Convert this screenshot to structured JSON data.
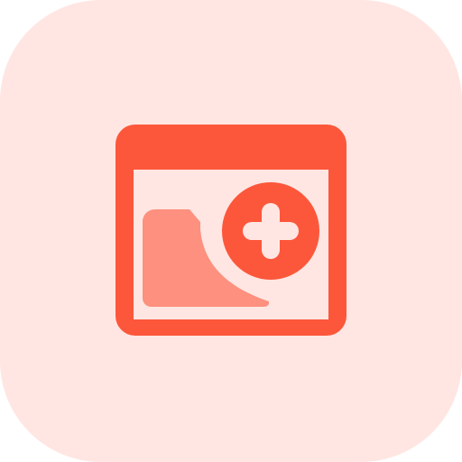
{
  "icon": {
    "name": "browser-folder-add-icon",
    "colors": {
      "background": "#FFE6E2",
      "primary": "#FC573B",
      "secondary": "#FD907E",
      "inner": "#FFE6E2"
    }
  }
}
